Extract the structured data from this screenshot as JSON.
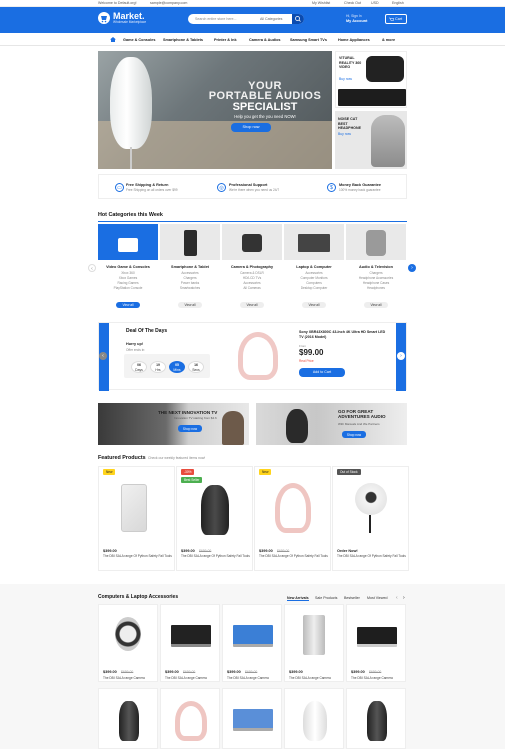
{
  "topbar": {
    "welcome": "Welcome to Default.org!",
    "email": "sample@company.com",
    "wishlist": "My Wishlist",
    "checkout": "Check Out",
    "currency": "USD",
    "language": "English"
  },
  "header": {
    "logo": "Market.",
    "tagline": "Wholesale Marketplace",
    "search_placeholder": "Search entire store here...",
    "search_category": "All Categories",
    "account_line1": "Hi, Sign In",
    "account_line2": "My Account",
    "cart_label": "Cart"
  },
  "nav": [
    "Home",
    "Game & Consoles",
    "Smartphone & Tablets",
    "Printer & Ink",
    "Camera & Audios",
    "Samsung Smart TVs",
    "Home Appliances",
    "& more"
  ],
  "hero": {
    "line1": "YOUR",
    "line2": "PORTABLE AUDIOS",
    "line3": "SPECIALIST",
    "subtext": "Help you get the you need NOW!",
    "button": "Shop now"
  },
  "side_banner_1": {
    "title": "VITURAL REALITY 360 VIDEO",
    "link": "Buy now"
  },
  "side_banner_2": {
    "title": "NOISE CAT BEST HEADPHONE",
    "link": "Buy now"
  },
  "services": [
    {
      "title": "Free Shipping & Return",
      "sub": "Free Shipping on all orders over $99",
      "icon": "truck-icon"
    },
    {
      "title": "Professional Support",
      "sub": "We're there when you need us 24/7",
      "icon": "globe-icon"
    },
    {
      "title": "Money Back Guarantee",
      "sub": "100% money back guarantee",
      "icon": "money-icon"
    }
  ],
  "hot_title": "Hot Categories this Week",
  "categories": [
    {
      "name": "Video Game & Consoles",
      "subs": [
        "Xbox 360",
        "Xbox Games",
        "Racing Games",
        "PlayStation Console"
      ],
      "view": "View all"
    },
    {
      "name": "Smartphone & Tablet",
      "subs": [
        "Accessories",
        "Chargers",
        "Power banks",
        "Smartwatches"
      ],
      "view": "View all"
    },
    {
      "name": "Camera & Photography",
      "subs": [
        "Camera & DSLR",
        "HD/LCD TVs",
        "Accessories",
        "All Cameras"
      ],
      "view": "View all"
    },
    {
      "name": "Laptop & Computer",
      "subs": [
        "Accessories",
        "Computer Monitors",
        "Computers",
        "Desktop Computer"
      ],
      "view": "View all"
    },
    {
      "name": "Audio & Television",
      "subs": [
        "Chargers",
        "Headphone Accessories",
        "Headphone Cases",
        "Headphones"
      ],
      "view": "View all"
    }
  ],
  "deal": {
    "title": "Deal Of The Days",
    "hurry": "Hurry up!",
    "offer": "Offer ends in:",
    "countdown": [
      {
        "num": "06",
        "unit": "Days"
      },
      {
        "num": "19",
        "unit": "Hrs"
      },
      {
        "num": "05",
        "unit": "Mins"
      },
      {
        "num": "16",
        "unit": "Secs"
      }
    ],
    "product": "Sony XBR43X800C 43-Inch 4K Ultra HD Smart LED TV (2016 Model)",
    "from": "From",
    "price": "$99.00",
    "real_price": "Real Price",
    "button": "Add to Cart"
  },
  "banners": [
    {
      "title": "THE NEXT INNOVATION TV",
      "sub": "Innovation TV starting from $4.6",
      "button": "Shop now"
    },
    {
      "title": "GO FOR GREAT ADVENTURES AUDIO",
      "sub": "With Manuals And We Partners",
      "button": "Shop now"
    }
  ],
  "featured": {
    "title": "Featured Products",
    "sub": "Check our weekly featured items now!",
    "items": [
      {
        "tag": "New",
        "tag2": "",
        "price": "$399.00",
        "old": "",
        "desc": "The DBI SALA range Of Python Safety Fall Tools"
      },
      {
        "tag": "-30%",
        "tag2": "Best Seller",
        "price": "$399.00",
        "old": "$699.00",
        "desc": "The DBI SALA range Of Python Safety Fall Tools"
      },
      {
        "tag": "New",
        "tag2": "",
        "price": "$399.00",
        "old": "$699.00",
        "desc": "The DBI SALA range Of Python Safety Fall Tools"
      },
      {
        "tag": "Out of Stock",
        "tag2": "",
        "price": "Order Now!",
        "old": "",
        "desc": "The DBI SALA range Of Python Safety Fall Tools"
      }
    ]
  },
  "computers": {
    "title": "Computers & Laptop Accessories",
    "tabs": [
      "New Arrivals",
      "Sale Products",
      "Bestseller",
      "Most Viewed"
    ],
    "row1": [
      {
        "price": "$399.00",
        "old": "$699.00",
        "desc": "The DBI SALA range Camera"
      },
      {
        "price": "$399.00",
        "old": "$699.00",
        "desc": "The DBI SALA range Camera"
      },
      {
        "price": "$399.00",
        "old": "$699.00",
        "desc": "The DBI SALA range Camera"
      },
      {
        "price": "$399.00",
        "old": "",
        "desc": "The DBI SALA range Camera"
      },
      {
        "price": "$399.00",
        "old": "$699.00",
        "desc": "The DBI SALA range Camera"
      }
    ]
  },
  "colors": {
    "brand": "#1a6ee2",
    "new_tag": "#ffd41c",
    "sale_tag": "#e84c3d",
    "best_tag": "#4caf50",
    "price_red": "#e84c3d"
  }
}
